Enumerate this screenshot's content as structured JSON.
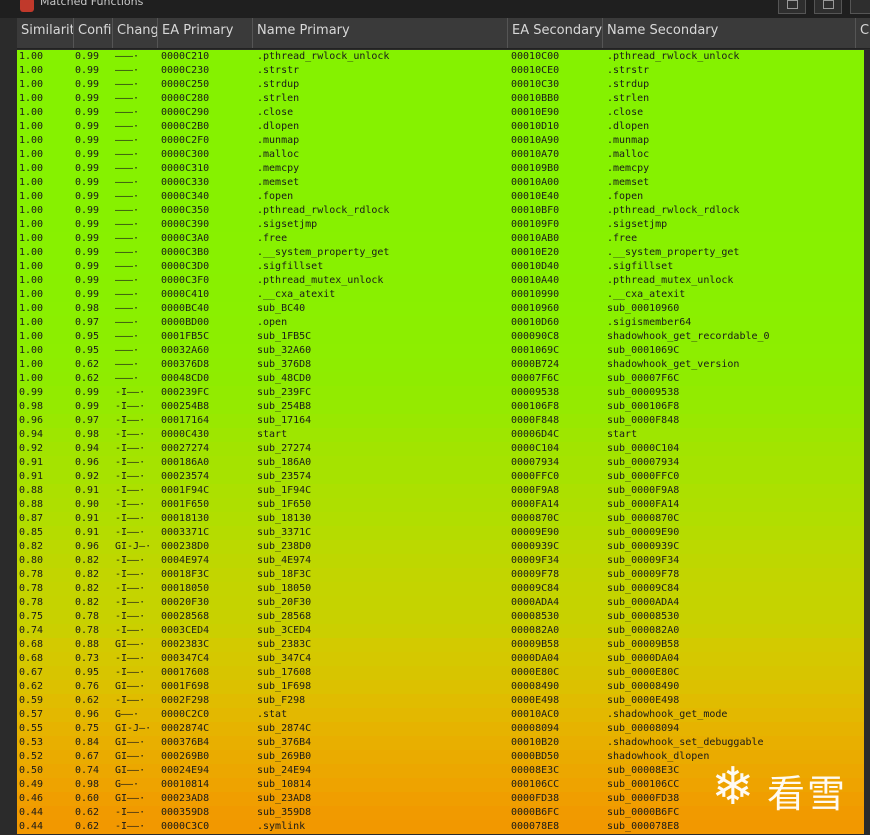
{
  "window": {
    "title": "Matched Functions"
  },
  "columns": [
    "Similarit",
    "Confi",
    "Change",
    "EA Primary",
    "Name Primary",
    "EA Secondary",
    "Name Secondary",
    "C"
  ],
  "rows": [
    {
      "sim": "1.00",
      "conf": "0.99",
      "change": "———·",
      "ea1": "0000C210",
      "name1": ".pthread_rwlock_unlock",
      "ea2": "00010C00",
      "name2": ".pthread_rwlock_unlock",
      "color": "#85f200"
    },
    {
      "sim": "1.00",
      "conf": "0.99",
      "change": "———·",
      "ea1": "0000C230",
      "name1": ".strstr",
      "ea2": "00010CE0",
      "name2": ".strstr",
      "color": "#85f200"
    },
    {
      "sim": "1.00",
      "conf": "0.99",
      "change": "———·",
      "ea1": "0000C250",
      "name1": ".strdup",
      "ea2": "00010C30",
      "name2": ".strdup",
      "color": "#85f200"
    },
    {
      "sim": "1.00",
      "conf": "0.99",
      "change": "———·",
      "ea1": "0000C280",
      "name1": ".strlen",
      "ea2": "00010BB0",
      "name2": ".strlen",
      "color": "#85f200"
    },
    {
      "sim": "1.00",
      "conf": "0.99",
      "change": "———·",
      "ea1": "0000C290",
      "name1": ".close",
      "ea2": "00010E90",
      "name2": ".close",
      "color": "#85f200"
    },
    {
      "sim": "1.00",
      "conf": "0.99",
      "change": "———·",
      "ea1": "0000C2B0",
      "name1": ".dlopen",
      "ea2": "00010D10",
      "name2": ".dlopen",
      "color": "#86f200"
    },
    {
      "sim": "1.00",
      "conf": "0.99",
      "change": "———·",
      "ea1": "0000C2F0",
      "name1": ".munmap",
      "ea2": "00010A90",
      "name2": ".munmap",
      "color": "#86f200"
    },
    {
      "sim": "1.00",
      "conf": "0.99",
      "change": "———·",
      "ea1": "0000C300",
      "name1": ".malloc",
      "ea2": "00010A70",
      "name2": ".malloc",
      "color": "#86f200"
    },
    {
      "sim": "1.00",
      "conf": "0.99",
      "change": "———·",
      "ea1": "0000C310",
      "name1": ".memcpy",
      "ea2": "000109B0",
      "name2": ".memcpy",
      "color": "#86f200"
    },
    {
      "sim": "1.00",
      "conf": "0.99",
      "change": "———·",
      "ea1": "0000C330",
      "name1": ".memset",
      "ea2": "00010A00",
      "name2": ".memset",
      "color": "#86f200"
    },
    {
      "sim": "1.00",
      "conf": "0.99",
      "change": "———·",
      "ea1": "0000C340",
      "name1": ".fopen",
      "ea2": "00010E40",
      "name2": ".fopen",
      "color": "#87f100"
    },
    {
      "sim": "1.00",
      "conf": "0.99",
      "change": "———·",
      "ea1": "0000C350",
      "name1": ".pthread_rwlock_rdlock",
      "ea2": "00010BF0",
      "name2": ".pthread_rwlock_rdlock",
      "color": "#87f100"
    },
    {
      "sim": "1.00",
      "conf": "0.99",
      "change": "———·",
      "ea1": "0000C390",
      "name1": ".sigsetjmp",
      "ea2": "000109F0",
      "name2": ".sigsetjmp",
      "color": "#87f100"
    },
    {
      "sim": "1.00",
      "conf": "0.99",
      "change": "———·",
      "ea1": "0000C3A0",
      "name1": ".free",
      "ea2": "00010AB0",
      "name2": ".free",
      "color": "#88f100"
    },
    {
      "sim": "1.00",
      "conf": "0.99",
      "change": "———·",
      "ea1": "0000C3B0",
      "name1": ".__system_property_get",
      "ea2": "00010E20",
      "name2": ".__system_property_get",
      "color": "#88f100"
    },
    {
      "sim": "1.00",
      "conf": "0.99",
      "change": "———·",
      "ea1": "0000C3D0",
      "name1": ".sigfillset",
      "ea2": "00010D40",
      "name2": ".sigfillset",
      "color": "#88f100"
    },
    {
      "sim": "1.00",
      "conf": "0.99",
      "change": "———·",
      "ea1": "0000C3F0",
      "name1": ".pthread_mutex_unlock",
      "ea2": "00010A40",
      "name2": ".pthread_mutex_unlock",
      "color": "#89f000"
    },
    {
      "sim": "1.00",
      "conf": "0.99",
      "change": "———·",
      "ea1": "0000C410",
      "name1": ".__cxa_atexit",
      "ea2": "00010990",
      "name2": ".__cxa_atexit",
      "color": "#89f000"
    },
    {
      "sim": "1.00",
      "conf": "0.98",
      "change": "———·",
      "ea1": "0000BC40",
      "name1": "sub_BC40",
      "ea2": "00010960",
      "name2": "sub_00010960",
      "color": "#8af000"
    },
    {
      "sim": "1.00",
      "conf": "0.97",
      "change": "———·",
      "ea1": "0000BD00",
      "name1": ".open",
      "ea2": "00010D60",
      "name2": ".sigismember64",
      "color": "#8bef00"
    },
    {
      "sim": "1.00",
      "conf": "0.95",
      "change": "———·",
      "ea1": "0001FB5C",
      "name1": "sub_1FB5C",
      "ea2": "000090C8",
      "name2": "shadowhook_get_recordable_0",
      "color": "#8cee00"
    },
    {
      "sim": "1.00",
      "conf": "0.95",
      "change": "———·",
      "ea1": "00032A60",
      "name1": "sub_32A60",
      "ea2": "0001069C",
      "name2": "sub_0001069C",
      "color": "#8dee00"
    },
    {
      "sim": "1.00",
      "conf": "0.62",
      "change": "———·",
      "ea1": "000376D8",
      "name1": "sub_376D8",
      "ea2": "0000B724",
      "name2": "shadowhook_get_version",
      "color": "#8eed00"
    },
    {
      "sim": "1.00",
      "conf": "0.62",
      "change": "———·",
      "ea1": "00048CD0",
      "name1": "sub_48CD0",
      "ea2": "00007F6C",
      "name2": "sub_00007F6C",
      "color": "#8fec00"
    },
    {
      "sim": "0.99",
      "conf": "0.99",
      "change": "-I——·",
      "ea1": "000239FC",
      "name1": "sub_239FC",
      "ea2": "00009538",
      "name2": "sub_00009538",
      "color": "#92eb00"
    },
    {
      "sim": "0.98",
      "conf": "0.99",
      "change": "-I——·",
      "ea1": "000254B8",
      "name1": "sub_254B8",
      "ea2": "000106F8",
      "name2": "sub_000106F8",
      "color": "#95ea00"
    },
    {
      "sim": "0.96",
      "conf": "0.97",
      "change": "-I——·",
      "ea1": "00017164",
      "name1": "sub_17164",
      "ea2": "0000F848",
      "name2": "sub_0000F848",
      "color": "#99e800"
    },
    {
      "sim": "0.94",
      "conf": "0.98",
      "change": "-I——·",
      "ea1": "0000C430",
      "name1": "start",
      "ea2": "00006D4C",
      "name2": "start",
      "color": "#9ee600"
    },
    {
      "sim": "0.92",
      "conf": "0.94",
      "change": "-I——·",
      "ea1": "00027274",
      "name1": "sub_27274",
      "ea2": "0000C104",
      "name2": "sub_0000C104",
      "color": "#a2e400"
    },
    {
      "sim": "0.91",
      "conf": "0.96",
      "change": "-I——·",
      "ea1": "000186A0",
      "name1": "sub_186A0",
      "ea2": "00007934",
      "name2": "sub_00007934",
      "color": "#a5e300"
    },
    {
      "sim": "0.91",
      "conf": "0.92",
      "change": "-I——·",
      "ea1": "00023574",
      "name1": "sub_23574",
      "ea2": "0000FFC0",
      "name2": "sub_0000FFC0",
      "color": "#a7e200"
    },
    {
      "sim": "0.88",
      "conf": "0.91",
      "change": "-I——·",
      "ea1": "0001F94C",
      "name1": "sub_1F94C",
      "ea2": "0000F9A8",
      "name2": "sub_0000F9A8",
      "color": "#ace000"
    },
    {
      "sim": "0.88",
      "conf": "0.90",
      "change": "-I——·",
      "ea1": "0001F650",
      "name1": "sub_1F650",
      "ea2": "0000FA14",
      "name2": "sub_0000FA14",
      "color": "#aedf00"
    },
    {
      "sim": "0.87",
      "conf": "0.91",
      "change": "-I——·",
      "ea1": "00018130",
      "name1": "sub_18130",
      "ea2": "0000870C",
      "name2": "sub_0000870C",
      "color": "#b1de00"
    },
    {
      "sim": "0.85",
      "conf": "0.91",
      "change": "-I——·",
      "ea1": "0003371C",
      "name1": "sub_3371C",
      "ea2": "00009E90",
      "name2": "sub_00009E90",
      "color": "#b5dc00"
    },
    {
      "sim": "0.82",
      "conf": "0.96",
      "change": "GI-J—·",
      "ea1": "000238D0",
      "name1": "sub_238D0",
      "ea2": "0000939C",
      "name2": "sub_0000939C",
      "color": "#bbd900"
    },
    {
      "sim": "0.80",
      "conf": "0.82",
      "change": "-I——·",
      "ea1": "0004E974",
      "name1": "sub_4E974",
      "ea2": "00009F34",
      "name2": "sub_00009F34",
      "color": "#bed700"
    },
    {
      "sim": "0.78",
      "conf": "0.82",
      "change": "-I——·",
      "ea1": "00018F3C",
      "name1": "sub_18F3C",
      "ea2": "00009F78",
      "name2": "sub_00009F78",
      "color": "#c2d500"
    },
    {
      "sim": "0.78",
      "conf": "0.82",
      "change": "-I——·",
      "ea1": "00018050",
      "name1": "sub_18050",
      "ea2": "00009C84",
      "name2": "sub_00009C84",
      "color": "#c4d400"
    },
    {
      "sim": "0.78",
      "conf": "0.82",
      "change": "-I——·",
      "ea1": "00020F30",
      "name1": "sub_20F30",
      "ea2": "0000ADA4",
      "name2": "sub_0000ADA4",
      "color": "#c5d300"
    },
    {
      "sim": "0.75",
      "conf": "0.78",
      "change": "-I——·",
      "ea1": "00028568",
      "name1": "sub_28568",
      "ea2": "00008530",
      "name2": "sub_00008530",
      "color": "#c8d100"
    },
    {
      "sim": "0.74",
      "conf": "0.78",
      "change": "-I——·",
      "ea1": "0003CED4",
      "name1": "sub_3CED4",
      "ea2": "000082A0",
      "name2": "sub_000082A0",
      "color": "#cbcf00"
    },
    {
      "sim": "0.68",
      "conf": "0.88",
      "change": "GI——·",
      "ea1": "0002383C",
      "name1": "sub_2383C",
      "ea2": "00009B58",
      "name2": "sub_00009B58",
      "color": "#d3ca00"
    },
    {
      "sim": "0.68",
      "conf": "0.73",
      "change": "-I——·",
      "ea1": "000347C4",
      "name1": "sub_347C4",
      "ea2": "0000DA04",
      "name2": "sub_0000DA04",
      "color": "#d5c800"
    },
    {
      "sim": "0.67",
      "conf": "0.95",
      "change": "-I——·",
      "ea1": "00017608",
      "name1": "sub_17608",
      "ea2": "0000E80C",
      "name2": "sub_0000E80C",
      "color": "#d7c500"
    },
    {
      "sim": "0.62",
      "conf": "0.76",
      "change": "GI——·",
      "ea1": "0001F698",
      "name1": "sub_1F698",
      "ea2": "00008490",
      "name2": "sub_00008490",
      "color": "#dcc100"
    },
    {
      "sim": "0.59",
      "conf": "0.62",
      "change": "-I——·",
      "ea1": "0002F298",
      "name1": "sub_F298",
      "ea2": "0000E498",
      "name2": "sub_0000E498",
      "color": "#e0bc00"
    },
    {
      "sim": "0.57",
      "conf": "0.96",
      "change": "G——·",
      "ea1": "0000C2C0",
      "name1": ".stat",
      "ea2": "00010AC0",
      "name2": ".shadowhook_get_mode",
      "color": "#e3b800"
    },
    {
      "sim": "0.55",
      "conf": "0.75",
      "change": "GI-J—·",
      "ea1": "0002874C",
      "name1": "sub_2874C",
      "ea2": "00008094",
      "name2": "sub_00008094",
      "color": "#e6b300"
    },
    {
      "sim": "0.53",
      "conf": "0.84",
      "change": "GI——·",
      "ea1": "000376B4",
      "name1": "sub_376B4",
      "ea2": "00010B20",
      "name2": ".shadowhook_set_debuggable",
      "color": "#e8af00"
    },
    {
      "sim": "0.52",
      "conf": "0.67",
      "change": "GI——·",
      "ea1": "000269B0",
      "name1": "sub_269B0",
      "ea2": "0000BD50",
      "name2": "shadowhook_dlopen",
      "color": "#eaab00"
    },
    {
      "sim": "0.50",
      "conf": "0.74",
      "change": "GI——·",
      "ea1": "00024E94",
      "name1": "sub_24E94",
      "ea2": "00008E3C",
      "name2": "sub_00008E3C",
      "color": "#eca700"
    },
    {
      "sim": "0.49",
      "conf": "0.98",
      "change": "G——·",
      "ea1": "00010814",
      "name1": "sub_10814",
      "ea2": "000106CC",
      "name2": "sub_000106CC",
      "color": "#eea300"
    },
    {
      "sim": "0.46",
      "conf": "0.60",
      "change": "GI——·",
      "ea1": "00023AD8",
      "name1": "sub_23AD8",
      "ea2": "0000FD38",
      "name2": "sub_0000FD38",
      "color": "#f09e00"
    },
    {
      "sim": "0.44",
      "conf": "0.62",
      "change": "-I——·",
      "ea1": "000359D8",
      "name1": "sub_359D8",
      "ea2": "0000B6FC",
      "name2": "sub_0000B6FC",
      "color": "#f19a00"
    },
    {
      "sim": "0.44",
      "conf": "0.62",
      "change": "-I——·",
      "ea1": "0000C3C0",
      "name1": ".symlink",
      "ea2": "000078E8",
      "name2": "sub_000078E8",
      "color": "#f29800"
    }
  ],
  "watermark": {
    "glyph": "❄",
    "text": "看雪"
  }
}
